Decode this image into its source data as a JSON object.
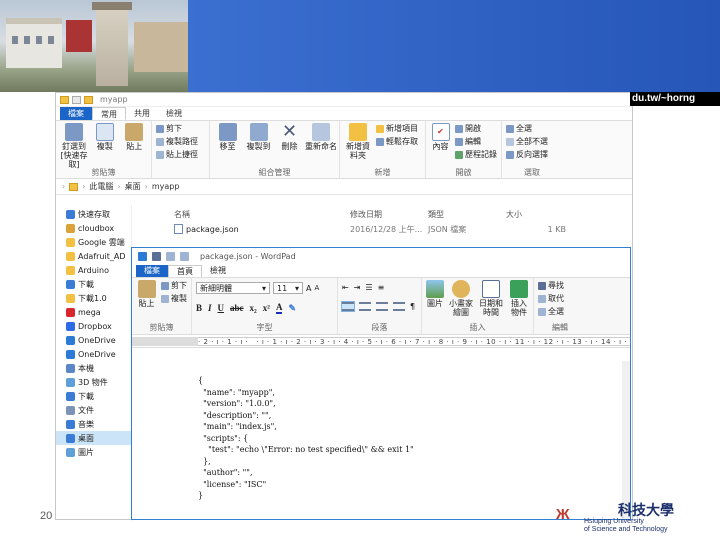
{
  "slide": {
    "url_text": "du.tw/~horng",
    "page_number": "20",
    "logo": {
      "chinese": "科技大學",
      "english_line1": "Hsiuping University",
      "english_line2": "of Science and Technology"
    }
  },
  "explorer": {
    "title": "myapp",
    "tabs": [
      "檔案",
      "常用",
      "共用",
      "檢視"
    ],
    "ribbon": {
      "clipboard": {
        "name": "剪貼簿",
        "pin_label": "釘選到[快速存取]",
        "copy_label": "複製",
        "paste_label": "貼上",
        "cut_label": "剪下",
        "copy_path_label": "複製路徑",
        "paste_shortcut_label": "貼上捷徑"
      },
      "organize": {
        "name": "組合管理",
        "move_label": "移至",
        "copy_to_label": "複製到",
        "delete_label": "刪除",
        "rename_label": "重新命名"
      },
      "new": {
        "name": "新增",
        "new_folder_label": "新增資料夾",
        "new_item_label": "新增項目",
        "easy_access_label": "輕鬆存取"
      },
      "open": {
        "name": "開啟",
        "properties_label": "內容",
        "open_label": "開啟",
        "edit_label": "編輯",
        "history_label": "歷程記錄"
      },
      "select": {
        "name": "選取",
        "select_all_label": "全選",
        "select_none_label": "全部不選",
        "invert_label": "反向選擇"
      }
    },
    "address": {
      "crumbs": [
        "此電腦",
        "桌面",
        "myapp"
      ]
    },
    "nav_items": [
      {
        "label": "快速存取",
        "color": "#3a7bd5"
      },
      {
        "label": "cloudbox",
        "color": "#d9a23a"
      },
      {
        "label": "Google 雲端",
        "color": "#f2c144"
      },
      {
        "label": "Adafruit_AD",
        "color": "#f2c144"
      },
      {
        "label": "Arduino",
        "color": "#f2c144"
      },
      {
        "label": "下載",
        "color": "#3a7bd5"
      },
      {
        "label": "下載1.0",
        "color": "#f2c144"
      },
      {
        "label": "mega",
        "color": "#d9262c"
      },
      {
        "label": "Dropbox",
        "color": "#2d6ce6"
      },
      {
        "label": "OneDrive",
        "color": "#2a7ad6"
      },
      {
        "label": "OneDrive",
        "color": "#2a7ad6"
      },
      {
        "label": "本機",
        "color": "#5b87c7"
      },
      {
        "label": "3D 物件",
        "color": "#5fa0d9"
      },
      {
        "label": "下載",
        "color": "#3a7bd5"
      },
      {
        "label": "文件",
        "color": "#7b93b6"
      },
      {
        "label": "音樂",
        "color": "#3a7bd5"
      },
      {
        "label": "桌面",
        "color": "#3a7bd5"
      },
      {
        "label": "圖片",
        "color": "#5fa0d9"
      }
    ],
    "file_headers": {
      "name": "名稱",
      "date": "修改日期",
      "type": "類型",
      "size": "大小"
    },
    "files": [
      {
        "name": "package.json",
        "date": "2016/12/28 上午...",
        "type": "JSON 檔案",
        "size": "1 KB"
      }
    ]
  },
  "wordpad": {
    "title": "package.json - WordPad",
    "tabs": [
      "檔案",
      "首頁",
      "檢視"
    ],
    "ribbon": {
      "clipboard": {
        "name": "剪貼簿",
        "paste_label": "貼上",
        "cut_label": "剪下",
        "copy_label": "複製"
      },
      "font": {
        "name": "字型",
        "font_name": "新細明體",
        "font_size": "11"
      },
      "paragraph": {
        "name": "段落"
      },
      "insert": {
        "name": "插入",
        "picture_label": "圖片",
        "paint_label": "小畫家繪圖",
        "datetime_label": "日期和時間",
        "object_label": "插入物件"
      },
      "edit": {
        "name": "編輯",
        "find_label": "尋找",
        "replace_label": "取代",
        "select_all_label": "全選"
      }
    },
    "ruler_text": "· 2 · ı · 1 · ı ·   · ı · 1 · ı · 2 · ı · 3 · ı · 4 · ı · 5 · ı · 6 · ı · 7 · ı · 8 · ı · 9 · ı · 10 · ı · 11 · ı · 12 · ı · 13 · ı · 14 · ı · 15 · ı · 16 · ı · 17 · ı",
    "document_text": "{\n  \"name\": \"myapp\",\n  \"version\": \"1.0.0\",\n  \"description\": \"\",\n  \"main\": \"index.js\",\n  \"scripts\": {\n    \"test\": \"echo \\\"Error: no test specified\\\" && exit 1\"\n  },\n  \"author\": \"\",\n  \"license\": \"ISC\"\n}"
  }
}
